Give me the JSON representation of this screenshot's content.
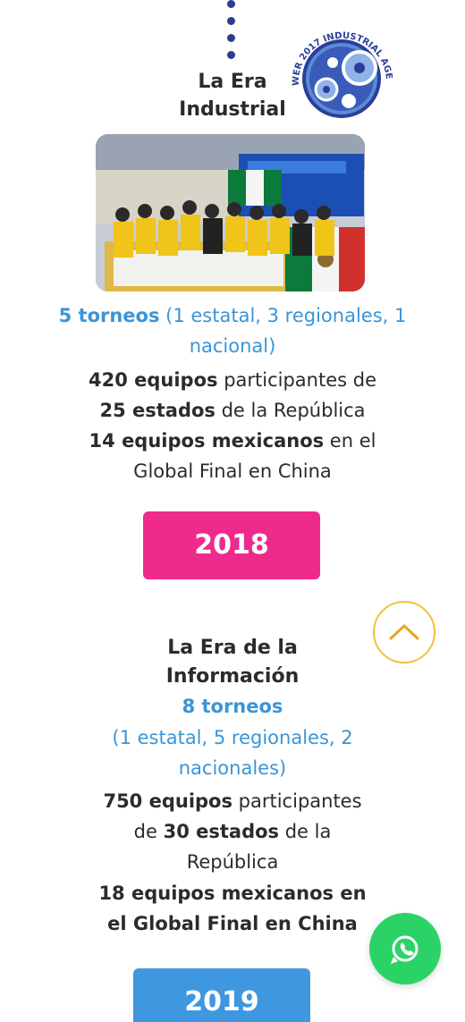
{
  "section_2017": {
    "title_line1": "La Era",
    "title_line2": "Industrial",
    "badge_text": "WER 2017 INDUSTRIAL AGE",
    "tournaments_strong": "5 torneos",
    "tournaments_detail": " (1 estatal, 3 regionales, 1 nacional)",
    "teams_strong": "420 equipos",
    "teams_rest": " participantes de",
    "states_strong": "25 estados",
    "states_rest": " de la República",
    "global_strong": "14 equipos mexicanos",
    "global_rest": " en el Global Final en China"
  },
  "year_2018": "2018",
  "section_2018": {
    "title_line1": "La Era de la",
    "title_line2": "Información",
    "tournaments": "8 torneos",
    "tournaments_detail_line1": "(1 estatal, 5 regionales, 2",
    "tournaments_detail_line2": "nacionales)",
    "teams_strong": "750 equipos",
    "teams_rest": " participantes",
    "de": "de ",
    "states_strong": "30 estados",
    "states_rest": " de la",
    "republica": "República",
    "global_line1": "18 equipos mexicanos en",
    "global_line2": "el Global Final en China"
  },
  "year_2019": "2019",
  "colors": {
    "pink": "#ee2b8d",
    "blue": "#3b95d6",
    "navy": "#2e3d91",
    "whatsapp": "#2bd366",
    "scroll_ring": "#f0c23a"
  }
}
